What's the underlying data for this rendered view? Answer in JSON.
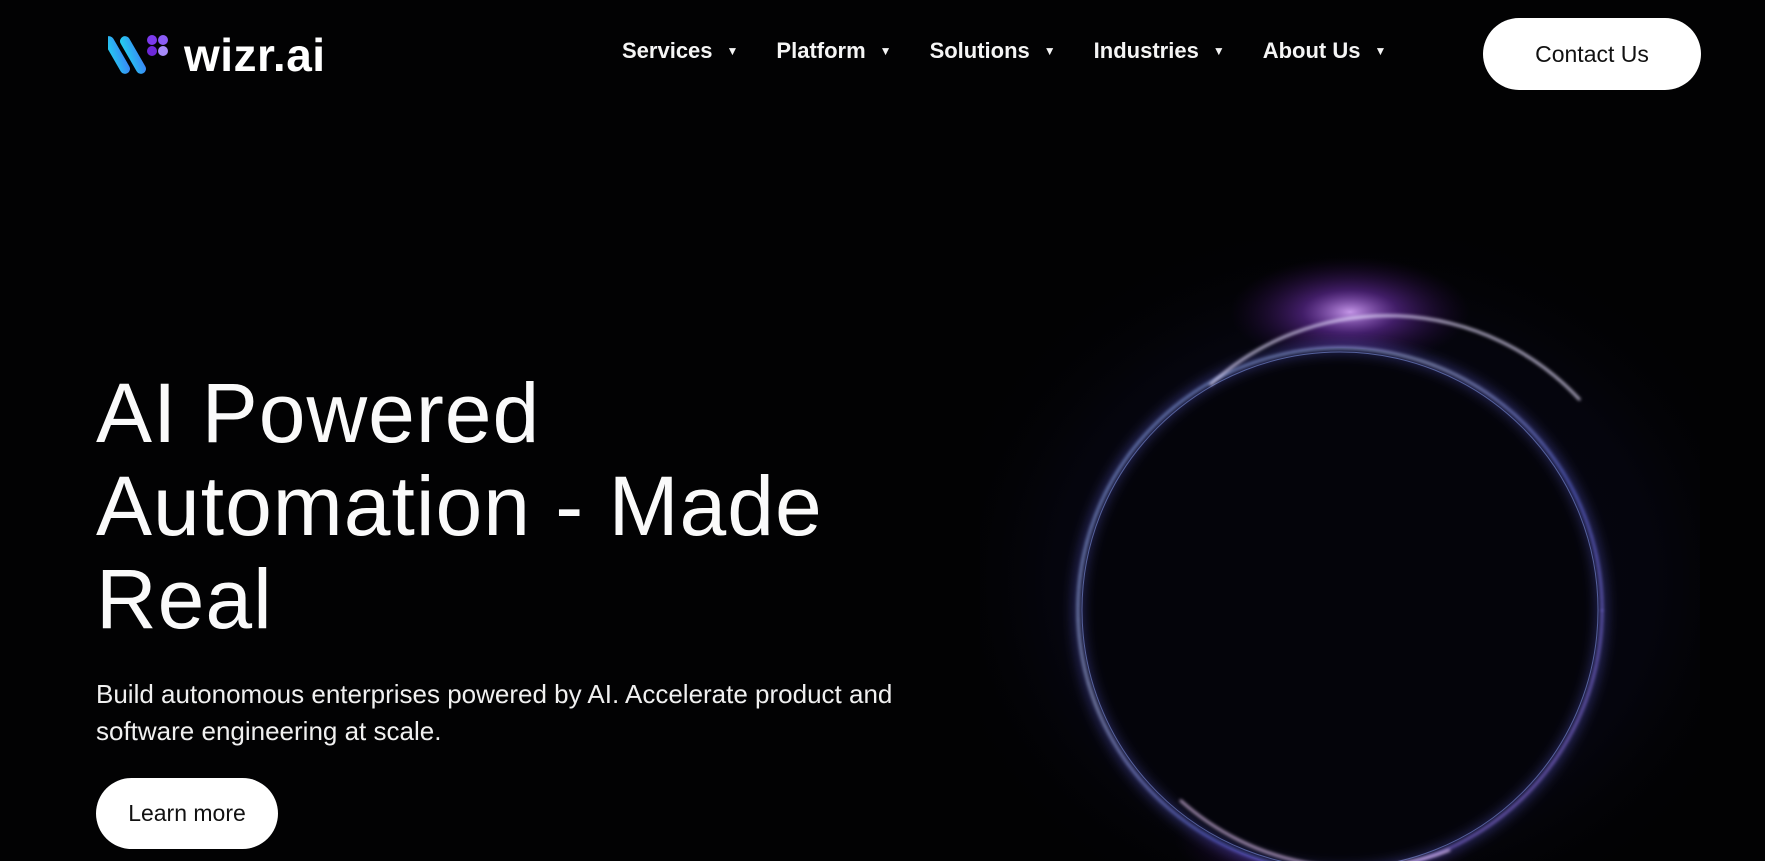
{
  "brand": {
    "name": "wizr.ai"
  },
  "nav": {
    "items": [
      {
        "label": "Services"
      },
      {
        "label": "Platform"
      },
      {
        "label": "Solutions"
      },
      {
        "label": "Industries"
      },
      {
        "label": "About Us"
      }
    ],
    "caret": "▼"
  },
  "header": {
    "contact_label": "Contact Us"
  },
  "hero": {
    "title_line1": "AI Powered",
    "title_line2": "Automation - Made",
    "title_line3": "Real",
    "subtitle_line1": "Build autonomous enterprises powered by AI. Accelerate product and",
    "subtitle_line2": "software engineering at scale.",
    "cta_label": "Learn more"
  },
  "colors": {
    "background": "#020203",
    "logo_cyan": "#22d3ee",
    "logo_blue": "#3b82f6",
    "logo_purple": "#8b5cf6",
    "glow_purple": "#b36bff",
    "button_bg": "#ffffff"
  }
}
